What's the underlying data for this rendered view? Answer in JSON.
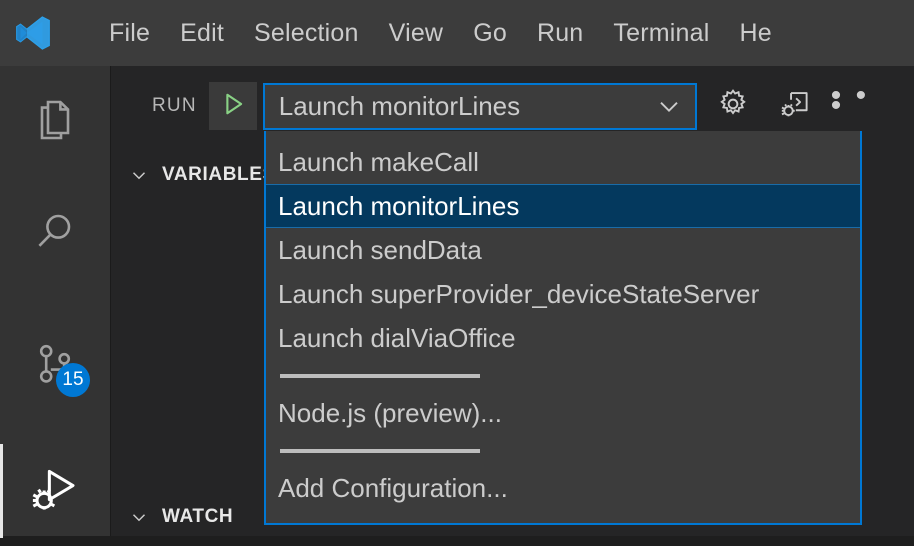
{
  "window": {
    "logo_icon": "vscode-logo-icon",
    "menus": [
      "File",
      "Edit",
      "Selection",
      "View",
      "Go",
      "Run",
      "Terminal",
      "He"
    ]
  },
  "activity_bar": {
    "items": [
      {
        "name": "explorer",
        "icon": "files-icon",
        "active": false,
        "badge": null
      },
      {
        "name": "search",
        "icon": "search-icon",
        "active": false,
        "badge": null
      },
      {
        "name": "source-control",
        "icon": "source-control-icon",
        "active": false,
        "badge": "15"
      },
      {
        "name": "run-and-debug",
        "icon": "run-and-debug-icon",
        "active": true,
        "badge": null
      }
    ]
  },
  "run_toolbar": {
    "label": "RUN",
    "start_icon": "play-icon",
    "selected_configuration": "Launch monitorLines",
    "chevron_icon": "chevron-down-icon",
    "gear_icon": "gear-icon",
    "debug_console_icon": "debug-console-icon",
    "more_actions_label": "• • •"
  },
  "sidebar_sections": [
    {
      "title": "VARIABLES",
      "chevron": "chevron-down-icon",
      "expanded": true
    },
    {
      "title": "WATCH",
      "chevron": "chevron-down-icon",
      "expanded": true
    }
  ],
  "dropdown": {
    "items": [
      {
        "type": "item",
        "label": "Launch makeCall",
        "selected": false
      },
      {
        "type": "item",
        "label": "Launch monitorLines",
        "selected": true
      },
      {
        "type": "item",
        "label": "Launch sendData",
        "selected": false
      },
      {
        "type": "item",
        "label": "Launch superProvider_deviceStateServer",
        "selected": false
      },
      {
        "type": "item",
        "label": "Launch dialViaOffice",
        "selected": false
      },
      {
        "type": "separator",
        "label": ""
      },
      {
        "type": "item",
        "label": "Node.js (preview)...",
        "selected": false
      },
      {
        "type": "separator",
        "label": ""
      },
      {
        "type": "item",
        "label": "Add Configuration...",
        "selected": false
      }
    ]
  },
  "colors": {
    "titlebar_bg": "#3c3c3c",
    "activitybar_bg": "#333333",
    "sidebar_bg": "#252526",
    "editor_bg": "#1e1e1e",
    "focus_border": "#0078d4",
    "list_bg": "#3c3c3c",
    "selection_bg": "#04395e",
    "badge_bg": "#0078d4",
    "play_green": "#89d185",
    "text": "#cccccc"
  }
}
